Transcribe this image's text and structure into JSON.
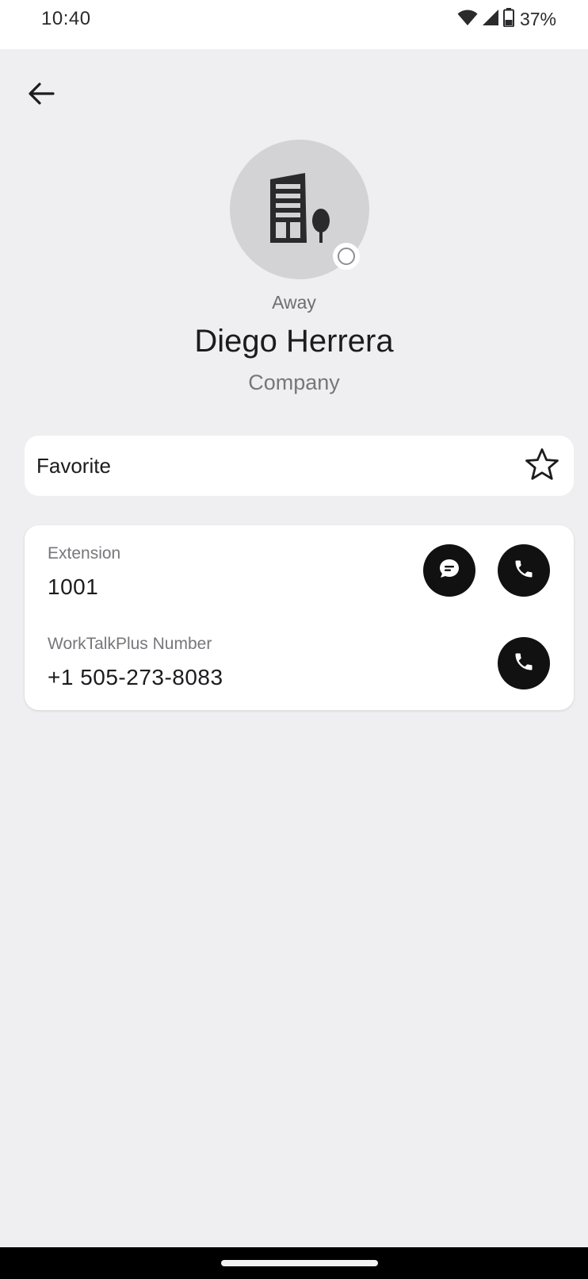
{
  "status_bar": {
    "time": "10:40",
    "battery": "37%",
    "icons": [
      "wifi-icon",
      "signal-icon",
      "battery-icon"
    ]
  },
  "header": {
    "back_icon": "arrow-left-icon"
  },
  "contact": {
    "avatar_icon": "building-icon",
    "presence": "Away",
    "name": "Diego Herrera",
    "type": "Company"
  },
  "favorite": {
    "label": "Favorite",
    "icon": "star-outline-icon"
  },
  "numbers": [
    {
      "label": "Extension",
      "value": "1001",
      "actions": [
        "message-icon",
        "phone-icon"
      ]
    },
    {
      "label": "WorkTalkPlus Number",
      "value": "+1 505-273-8083",
      "actions": [
        "phone-icon"
      ]
    }
  ],
  "colors": {
    "background": "#efeff2",
    "card": "#ffffff",
    "action_button": "#111111",
    "avatar_bg": "#d3d3d6"
  }
}
